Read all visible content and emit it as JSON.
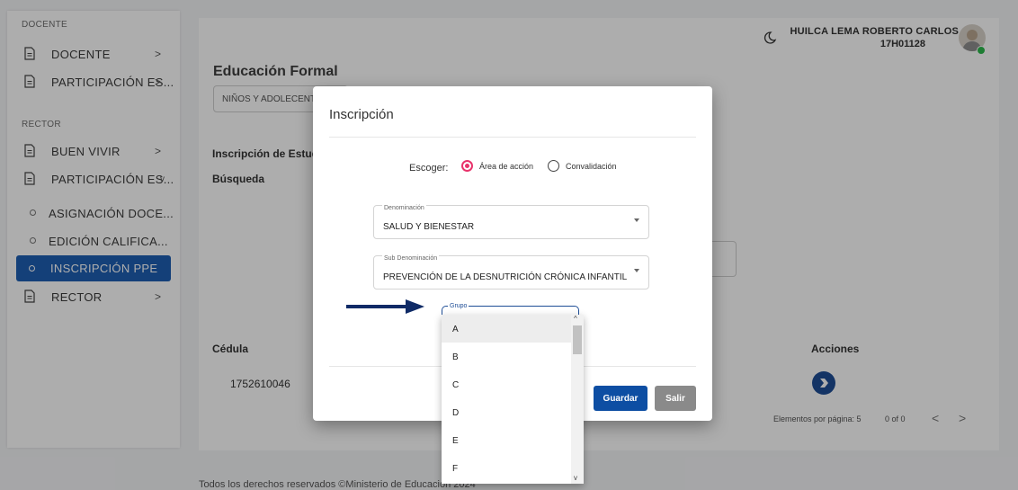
{
  "sidebar": {
    "section_docente": "DOCENTE",
    "section_rector": "RECTOR",
    "items": [
      {
        "label": "DOCENTE",
        "chevron": ">"
      },
      {
        "label": "PARTICIPACIÓN ES...",
        "chevron": ">"
      },
      {
        "label": "BUEN VIVIR",
        "chevron": ">"
      },
      {
        "label": "PARTICIPACIÓN ES...",
        "chevron": "v"
      },
      {
        "label": "ASIGNACIÓN DOCE..."
      },
      {
        "label": "EDICIÓN CALIFICA..."
      },
      {
        "label": "INSCRIPCIÓN PPE"
      },
      {
        "label": "RECTOR",
        "chevron": ">"
      }
    ]
  },
  "header": {
    "user_name": "HUILCA LEMA ROBERTO CARLOS",
    "user_code": "17H01128",
    "status_color": "#2db84c"
  },
  "page": {
    "title": "Educación Formal",
    "select_value": "NIÑOS Y ADOLECENT",
    "section_heading": "Inscripción de Estudi",
    "search_label": "Búsqueda",
    "col_cedula": "Cédula",
    "col_acciones": "Acciones",
    "cedula_value": "1752610046",
    "pager_label": "Elementos por página: 5",
    "pager_range": "0 of 0",
    "pager_prev": "<",
    "pager_next": ">",
    "footer": "Todos los derechos reservados ©Ministerio de Educación 2024"
  },
  "dialog": {
    "title": "Inscripción",
    "escoger_label": "Escoger:",
    "radio_area": "Área de acción",
    "radio_conv": "Convalidación",
    "denominacion_label": "Denominación",
    "denominacion_value": "SALUD Y BIENESTAR",
    "subden_label": "Sub Denominación",
    "subden_value": "PREVENCIÓN DE LA DESNUTRICIÓN CRÓNICA INFANTIL",
    "grupo_label": "Grupo",
    "grupo_options": [
      "A",
      "B",
      "C",
      "D",
      "E",
      "F"
    ],
    "save_label": "Guardar",
    "exit_label": "Salir"
  }
}
